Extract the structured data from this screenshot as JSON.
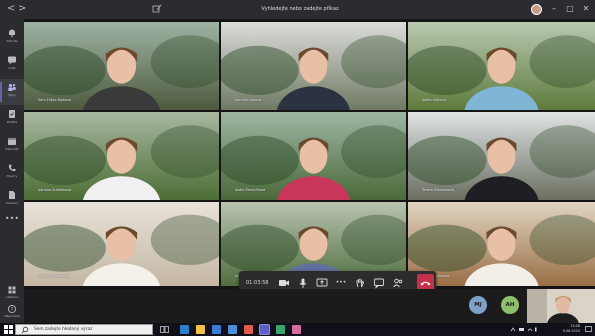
{
  "titlebar": {
    "back_label": "<",
    "forward_label": ">",
    "title": "Vyhledejte nebo zadejte příkaz",
    "minimize_label": "–",
    "maximize_label": "□",
    "close_label": "✕",
    "more_label": "⋯",
    "icons": {
      "compose": "compose-icon",
      "avatar": "user-avatar"
    }
  },
  "rail": {
    "items": [
      {
        "label": "Aktivita",
        "icon": "bell-icon"
      },
      {
        "label": "Chat",
        "icon": "chat-icon"
      },
      {
        "label": "Týmy",
        "icon": "teams-icon",
        "active": true
      },
      {
        "label": "Zadání",
        "icon": "assignments-icon"
      },
      {
        "label": "Kalendář",
        "icon": "calendar-icon"
      },
      {
        "label": "Hovory",
        "icon": "phone-icon"
      },
      {
        "label": "Soubory",
        "icon": "files-icon"
      }
    ],
    "more_label": "•••",
    "apps_label": "Aplikace",
    "help_label": "Nápověda"
  },
  "participants": [
    {
      "name": "Sára Eliška Boiková",
      "bg": [
        "#9fb3a4",
        "#4d5a3e"
      ],
      "shirt": "#3a3a3a"
    },
    {
      "name": "Karolína Jirková",
      "bg": [
        "#dcdcda",
        "#6f7a64"
      ],
      "shirt": "#2b3340"
    },
    {
      "name": "Adéla Hájková",
      "bg": [
        "#b9c8b0",
        "#5f7a3c"
      ],
      "shirt": "#7fb6d6"
    },
    {
      "name": "Adriana Štefáňková",
      "bg": [
        "#a8b7a0",
        "#4c6e35"
      ],
      "shirt": "#f0f0f2"
    },
    {
      "name": "Adéla Žemličková",
      "bg": [
        "#9db6a3",
        "#4a6a3a"
      ],
      "shirt": "#c8375a"
    },
    {
      "name": "Tereza Štěpánková",
      "bg": [
        "#dfe3e4",
        "#6a6f60"
      ],
      "shirt": "#1e1e24"
    },
    {
      "name": "Veronika Vrabcová",
      "bg": [
        "#e8e2da",
        "#c4b7a3"
      ],
      "shirt": "#f4f0ea"
    },
    {
      "name": "Aneta Kamerová",
      "bg": [
        "#b9c3b0",
        "#506f3f"
      ],
      "shirt": "#5f6f9f"
    },
    {
      "name": "Nikola Kučerová",
      "bg": [
        "#e1d5c1",
        "#9a6e46"
      ],
      "shirt": "#f2eee8"
    }
  ],
  "toolbar": {
    "time": "01:03:58",
    "icons": [
      "camera-icon",
      "mic-icon",
      "share-screen-icon",
      "more-icon",
      "raise-hand-icon",
      "chat-icon",
      "participants-icon",
      "hang-up-icon"
    ],
    "more_label": "•••"
  },
  "bottom": {
    "avatars": [
      {
        "initials": "MJ",
        "color": "#7fa1c9"
      },
      {
        "initials": "AH",
        "color": "#8dbf6f"
      }
    ]
  },
  "taskbar": {
    "search_placeholder": "Sem zadejte hledaný výraz",
    "tray_time": "13:48",
    "tray_date": "5.06.2020",
    "colors": {
      "edge": "#2d7dd2",
      "explorer": "#f2c04a",
      "teams": "#5b5fc7",
      "store": "#3a7bd5"
    }
  }
}
